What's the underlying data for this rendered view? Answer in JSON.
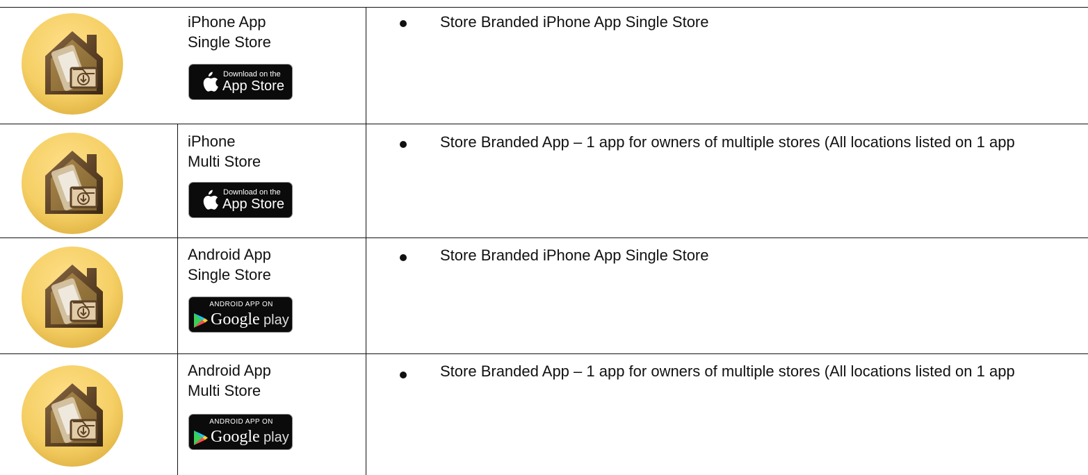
{
  "rows": [
    {
      "icon": "house-phone-download-icon",
      "title_line1": "iPhone App",
      "title_line2": "Single Store",
      "badge": {
        "kind": "app-store",
        "small": "Download on the",
        "large": "App Store"
      },
      "description": "Store Branded iPhone App Single Store"
    },
    {
      "icon": "house-phone-download-icon",
      "title_line1": "iPhone",
      "title_line2": "Multi Store",
      "badge": {
        "kind": "app-store",
        "small": "Download on the",
        "large": "App Store"
      },
      "description": "Store Branded App – 1 app for owners of multiple stores (All locations listed on 1 app"
    },
    {
      "icon": "house-phone-download-icon",
      "title_line1": "Android App",
      "title_line2": "Single Store",
      "badge": {
        "kind": "google-play",
        "small": "ANDROID APP ON",
        "google": "Google",
        "play": "play"
      },
      "description": "Store Branded iPhone App Single Store"
    },
    {
      "icon": "house-phone-download-icon",
      "title_line1": "Android App",
      "title_line2": "Multi Store",
      "badge": {
        "kind": "google-play",
        "small": "ANDROID APP ON",
        "google": "Google",
        "play": "play"
      },
      "description": "Store Branded App – 1 app for owners of multiple stores (All locations listed on 1 app"
    }
  ],
  "colors": {
    "icon_gold_light": "#f7d36b",
    "icon_gold_dark": "#e4b84a",
    "icon_house": "#6b4c2d",
    "badge_black": "#0b0b0b",
    "line": "#111111"
  }
}
